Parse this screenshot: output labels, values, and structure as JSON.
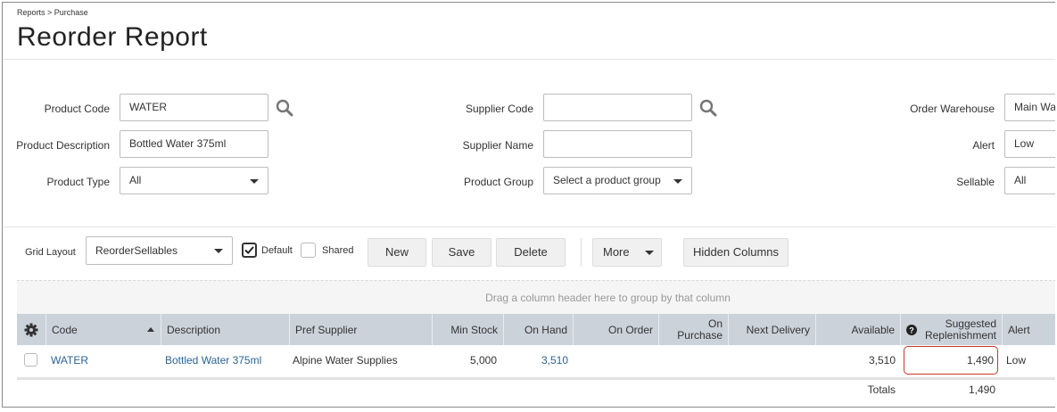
{
  "breadcrumb": "Reports > Purchase",
  "title": "Reorder Report",
  "filters": {
    "product_code": {
      "label": "Product Code",
      "value": "WATER"
    },
    "product_description": {
      "label": "Product Description",
      "value": "Bottled Water 375ml"
    },
    "product_type": {
      "label": "Product Type",
      "value": "All"
    },
    "supplier_code": {
      "label": "Supplier Code",
      "value": ""
    },
    "supplier_name": {
      "label": "Supplier Name",
      "value": ""
    },
    "product_group": {
      "label": "Product Group",
      "value": "Select a product group"
    },
    "order_warehouse": {
      "label": "Order Warehouse",
      "value": "Main Wa"
    },
    "alert": {
      "label": "Alert",
      "value": "Low"
    },
    "sellable": {
      "label": "Sellable",
      "value": "All"
    }
  },
  "toolbar": {
    "grid_layout_label": "Grid Layout",
    "grid_layout_value": "ReorderSellables",
    "default_label": "Default",
    "default_checked": true,
    "shared_label": "Shared",
    "shared_checked": false,
    "new_label": "New",
    "save_label": "Save",
    "delete_label": "Delete",
    "more_label": "More",
    "hidden_columns_label": "Hidden Columns"
  },
  "grid": {
    "group_hint": "Drag a column header here to group by that column",
    "columns": {
      "code": "Code",
      "description": "Description",
      "pref_supplier": "Pref Supplier",
      "min_stock": "Min Stock",
      "on_hand": "On Hand",
      "on_order": "On Order",
      "on_purchase_1": "On",
      "on_purchase_2": "Purchase",
      "next_delivery": "Next Delivery",
      "available": "Available",
      "suggested_1": "Suggested",
      "suggested_2": "Replenishment",
      "alert": "Alert"
    },
    "rows": [
      {
        "code": "WATER",
        "description": "Bottled Water 375ml",
        "pref_supplier": "Alpine Water Supplies",
        "min_stock": "5,000",
        "on_hand": "3,510",
        "on_order": "",
        "on_purchase": "",
        "next_delivery": "",
        "available": "3,510",
        "suggested_replenishment": "1,490",
        "alert": "Low"
      }
    ],
    "totals_label": "Totals",
    "totals_value": "1,490"
  },
  "icons": {
    "search": "magnifier-icon",
    "settings": "gear-icon",
    "sort": "sort-ascending-icon",
    "help": "question-circle-icon"
  },
  "colors": {
    "link": "#2a6496",
    "header_bg": "#cbd2da",
    "edit_cell_border": "#c0392b"
  }
}
